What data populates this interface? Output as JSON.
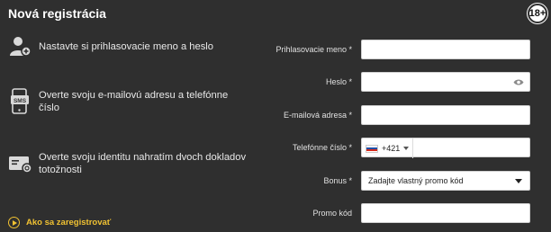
{
  "header": {
    "title": "Nová registrácia",
    "age_badge": "18+"
  },
  "steps": [
    {
      "icon": "user-add-icon",
      "text": "Nastavte si prihlasovacie meno a heslo"
    },
    {
      "icon": "sms-phone-icon",
      "text": "Overte svoju e-mailovú adresu a telefónne číslo"
    },
    {
      "icon": "id-card-icon",
      "text": "Overte svoju identitu nahratím dvoch dokladov totožnosti"
    }
  ],
  "howto": {
    "label": "Ako sa zaregistrovať",
    "icon": "play-circle-icon"
  },
  "form": {
    "username": {
      "label": "Prihlasovacie meno *",
      "value": ""
    },
    "password": {
      "label": "Heslo *",
      "value": "",
      "icon": "eye-icon"
    },
    "email": {
      "label": "E-mailová adresa *",
      "value": ""
    },
    "phone": {
      "label": "Telefónne číslo *",
      "country_flag": "slovakia-flag-icon",
      "prefix": "+421",
      "value": ""
    },
    "bonus": {
      "label": "Bonus *",
      "selected": "Zadajte vlastný promo kód"
    },
    "promo": {
      "label": "Promo kód",
      "value": ""
    }
  },
  "colors": {
    "background": "#2f2f2f",
    "accent": "#f1c232",
    "field": "#ffffff"
  }
}
